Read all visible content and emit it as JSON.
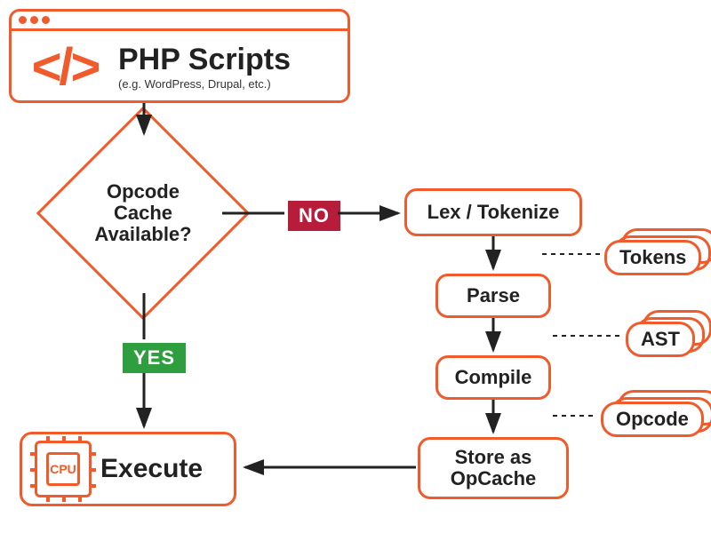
{
  "header": {
    "title": "PHP Scripts",
    "subtitle": "(e.g. WordPress, Drupal, etc.)",
    "icon_glyph": "</>"
  },
  "decision": {
    "label": "Opcode Cache Available?"
  },
  "badges": {
    "no": "NO",
    "yes": "YES"
  },
  "nodes": {
    "lex": "Lex / Tokenize",
    "parse": "Parse",
    "compile": "Compile",
    "store": "Store as OpCache",
    "execute": "Execute"
  },
  "outputs": {
    "tokens": "Tokens",
    "ast": "AST",
    "opcode": "Opcode"
  },
  "cpu_label": "CPU"
}
